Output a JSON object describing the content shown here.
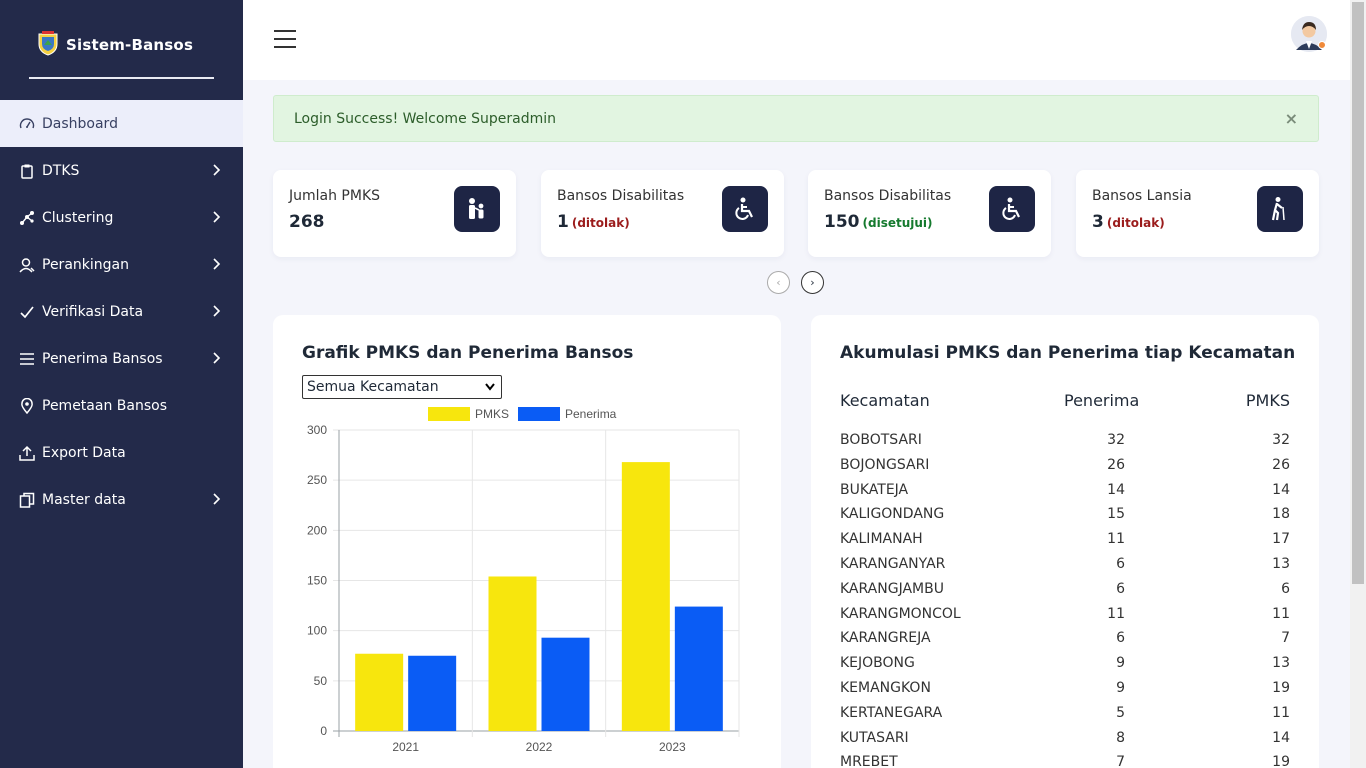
{
  "app": {
    "name": "Sistem-Bansos"
  },
  "sidebar": {
    "items": [
      {
        "label": "Dashboard",
        "icon": "speedometer-icon",
        "active": true,
        "chevron": false
      },
      {
        "label": "DTKS",
        "icon": "clipboard-icon",
        "chevron": true
      },
      {
        "label": "Clustering",
        "icon": "network-icon",
        "chevron": true
      },
      {
        "label": "Perankingan",
        "icon": "user-rank-icon",
        "chevron": true
      },
      {
        "label": "Verifikasi Data",
        "icon": "check-icon",
        "chevron": true
      },
      {
        "label": "Penerima Bansos",
        "icon": "list-icon",
        "chevron": true
      },
      {
        "label": "Pemetaan Bansos",
        "icon": "map-pin-icon",
        "chevron": false
      },
      {
        "label": "Export Data",
        "icon": "upload-icon",
        "chevron": false
      },
      {
        "label": "Master data",
        "icon": "copy-icon",
        "chevron": true
      }
    ]
  },
  "alert": {
    "message": "Login Success! Welcome Superadmin",
    "close": "×"
  },
  "cards": [
    {
      "label": "Jumlah PMKS",
      "value": "268",
      "badge": "",
      "badge_color": "",
      "icon": "family-icon"
    },
    {
      "label": "Bansos Disabilitas",
      "value": "1",
      "badge": "(ditolak)",
      "badge_color": "#9b1c1c",
      "icon": "wheelchair-icon"
    },
    {
      "label": "Bansos Disabilitas",
      "value": "150",
      "badge": "(disetujui)",
      "badge_color": "#157a2e",
      "icon": "wheelchair-icon"
    },
    {
      "label": "Bansos Lansia",
      "value": "3",
      "badge": "(ditolak)",
      "badge_color": "#9b1c1c",
      "icon": "elderly-cane-icon"
    }
  ],
  "carousel": {
    "prev": "‹",
    "next": "›"
  },
  "chart_panel": {
    "title": "Grafik PMKS dan Penerima Bansos",
    "select_value": "Semua Kecamatan"
  },
  "chart_data": {
    "type": "bar",
    "categories": [
      "2021",
      "2022",
      "2023"
    ],
    "series": [
      {
        "name": "PMKS",
        "values": [
          77,
          154,
          268
        ],
        "color": "#f7e60d"
      },
      {
        "name": "Penerima",
        "values": [
          75,
          93,
          124
        ],
        "color": "#0a5cf5"
      }
    ],
    "yticks": [
      "0",
      "50",
      "100",
      "150",
      "200",
      "250",
      "300"
    ],
    "ylim": [
      0,
      300
    ],
    "grid": true,
    "legend": "top"
  },
  "table_panel": {
    "title": "Akumulasi PMKS dan Penerima tiap Kecamatan",
    "columns": [
      "Kecamatan",
      "Penerima",
      "PMKS"
    ],
    "rows": [
      [
        "BOBOTSARI",
        "32",
        "32"
      ],
      [
        "BOJONGSARI",
        "26",
        "26"
      ],
      [
        "BUKATEJA",
        "14",
        "14"
      ],
      [
        "KALIGONDANG",
        "15",
        "18"
      ],
      [
        "KALIMANAH",
        "11",
        "17"
      ],
      [
        "KARANGANYAR",
        "6",
        "13"
      ],
      [
        "KARANGJAMBU",
        "6",
        "6"
      ],
      [
        "KARANGMONCOL",
        "11",
        "11"
      ],
      [
        "KARANGREJA",
        "6",
        "7"
      ],
      [
        "KEJOBONG",
        "9",
        "13"
      ],
      [
        "KEMANGKON",
        "9",
        "19"
      ],
      [
        "KERTANEGARA",
        "5",
        "11"
      ],
      [
        "KUTASARI",
        "8",
        "14"
      ],
      [
        "MREBET",
        "7",
        "19"
      ]
    ]
  }
}
